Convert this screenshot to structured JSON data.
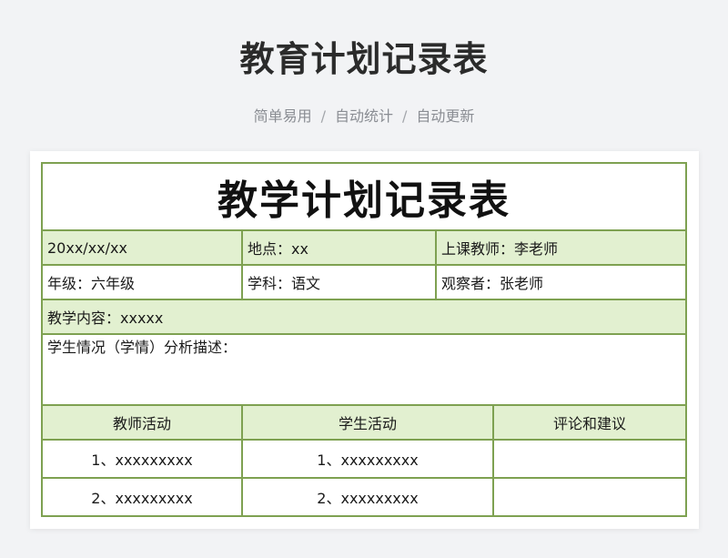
{
  "header": {
    "title": "教育计划记录表",
    "tags": [
      "简单易用",
      "自动统计",
      "自动更新"
    ],
    "separator": "/"
  },
  "sheet": {
    "title": "教学计划记录表",
    "date": "20xx/xx/xx",
    "location": "地点：xx",
    "teacher": "上课教师：李老师",
    "grade": "年级：六年级",
    "subject": "学科：语文",
    "observer": "观察者：张老师",
    "content": "教学内容：xxxxx",
    "analysis": "学生情况（学情）分析描述：",
    "columns": [
      "教师活动",
      "学生活动",
      "评论和建议"
    ],
    "rows": [
      {
        "teacher": "1、xxxxxxxxx",
        "student": "1、xxxxxxxxx",
        "comment": ""
      },
      {
        "teacher": "2、xxxxxxxxx",
        "student": "2、xxxxxxxxx",
        "comment": ""
      }
    ]
  },
  "colors": {
    "border": "#7ea151",
    "header_fill": "#e2f0d0",
    "background": "#f2f3f5"
  }
}
